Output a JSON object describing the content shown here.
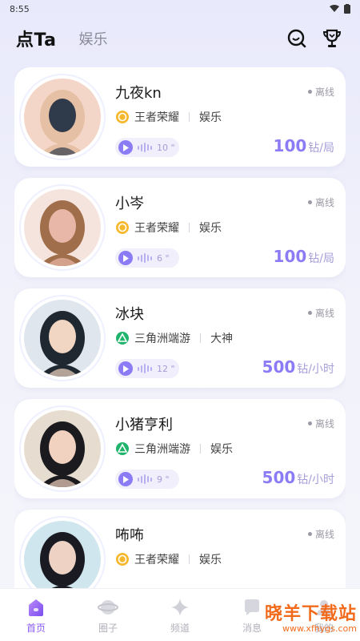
{
  "status_bar": {
    "time": "8:55"
  },
  "header": {
    "tabs": [
      "点Ta",
      "娱乐"
    ]
  },
  "cards": [
    {
      "name": "九夜kn",
      "status": "离线",
      "game": "王者荣耀",
      "game_color": "#f5b82e",
      "tag": "娱乐",
      "duration": "10 \"",
      "price": "100",
      "unit": "钻/局",
      "avatar_colors": [
        "#f3d6c8",
        "#e6c0a4",
        "#2f3b4a"
      ]
    },
    {
      "name": "小岑",
      "status": "离线",
      "game": "王者荣耀",
      "game_color": "#f5b82e",
      "tag": "娱乐",
      "duration": "6 \"",
      "price": "100",
      "unit": "钻/局",
      "avatar_colors": [
        "#f5e4de",
        "#a06e4a",
        "#e9b7a8"
      ]
    },
    {
      "name": "冰块",
      "status": "离线",
      "game": "三角洲端游",
      "game_color": "#1fb36b",
      "tag": "大神",
      "duration": "12 \"",
      "price": "500",
      "unit": "钻/小时",
      "avatar_colors": [
        "#dfe6ee",
        "#1f2730",
        "#f1d7c3"
      ]
    },
    {
      "name": "小猪亨利",
      "status": "离线",
      "game": "三角洲端游",
      "game_color": "#1fb36b",
      "tag": "娱乐",
      "duration": "9 \"",
      "price": "500",
      "unit": "钻/小时",
      "avatar_colors": [
        "#e6dccf",
        "#1b1a1f",
        "#f1d1c0"
      ]
    },
    {
      "name": "咘咘",
      "status": "离线",
      "game": "王者荣耀",
      "game_color": "#f5b82e",
      "tag": "娱乐",
      "duration": "",
      "price": "",
      "unit": "",
      "avatar_colors": [
        "#cfe6ee",
        "#1a1b22",
        "#eed2c4"
      ]
    }
  ],
  "tabbar": {
    "items": [
      {
        "label": "首页",
        "active": true
      },
      {
        "label": "圈子",
        "active": false
      },
      {
        "label": "频道",
        "active": false
      },
      {
        "label": "消息",
        "active": false
      },
      {
        "label": "我的",
        "active": false
      }
    ]
  },
  "watermark": {
    "title": "晓羊下载站",
    "url": "www.xfhygs.com"
  },
  "colors": {
    "accent": "#8b7cf6",
    "active_tab": "#8b5cf6"
  }
}
